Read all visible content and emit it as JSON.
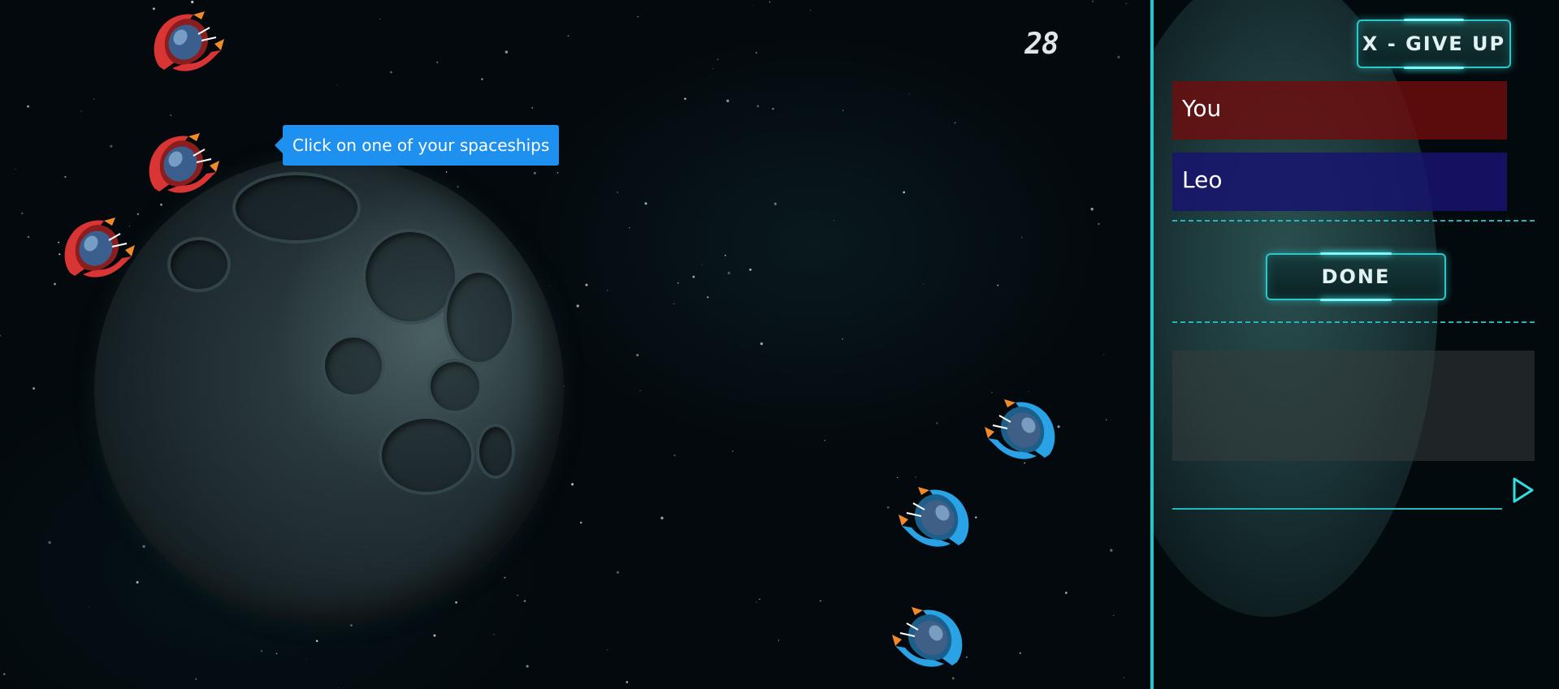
{
  "game": {
    "counter": "28",
    "tooltip": "Click on one of your spaceships",
    "red_ships": 3,
    "blue_ships": 3,
    "colors": {
      "red_team": "#d93535",
      "blue_team": "#2aa3e6",
      "accent": "#1fc8cc"
    },
    "icons": [
      "red-spaceship-icon",
      "blue-spaceship-icon",
      "planet-icon"
    ]
  },
  "panel": {
    "give_up_label": "X - GIVE UP",
    "players": [
      {
        "name": "You",
        "color": "#6e0e0e"
      },
      {
        "name": "Leo",
        "color": "#18146e"
      }
    ],
    "done_label": "DONE",
    "chat": {
      "placeholder": "",
      "send_icon": "send-arrow-icon"
    }
  }
}
